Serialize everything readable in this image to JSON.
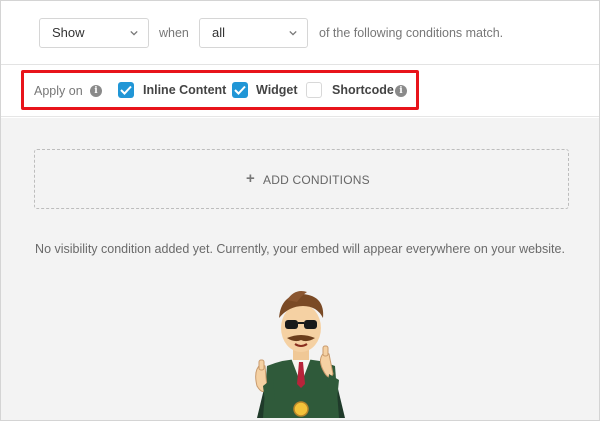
{
  "rule": {
    "action_select": "Show",
    "when_text": "when",
    "match_select": "all",
    "tail_text": "of the following conditions match."
  },
  "apply_on": {
    "label": "Apply on",
    "options": [
      {
        "label": "Inline Content",
        "checked": true
      },
      {
        "label": "Widget",
        "checked": true
      },
      {
        "label": "Shortcode",
        "checked": false
      }
    ]
  },
  "conditions": {
    "add_label": "ADD CONDITIONS",
    "empty_message": "No visibility condition added yet. Currently, your embed will appear everywhere on your website."
  },
  "colors": {
    "checkbox_accent": "#2196d6",
    "highlight": "#e8141b"
  },
  "icons": {
    "select_chevron": "chevron-down-icon",
    "info": "info-icon",
    "add": "plus-icon",
    "check": "check-icon"
  }
}
